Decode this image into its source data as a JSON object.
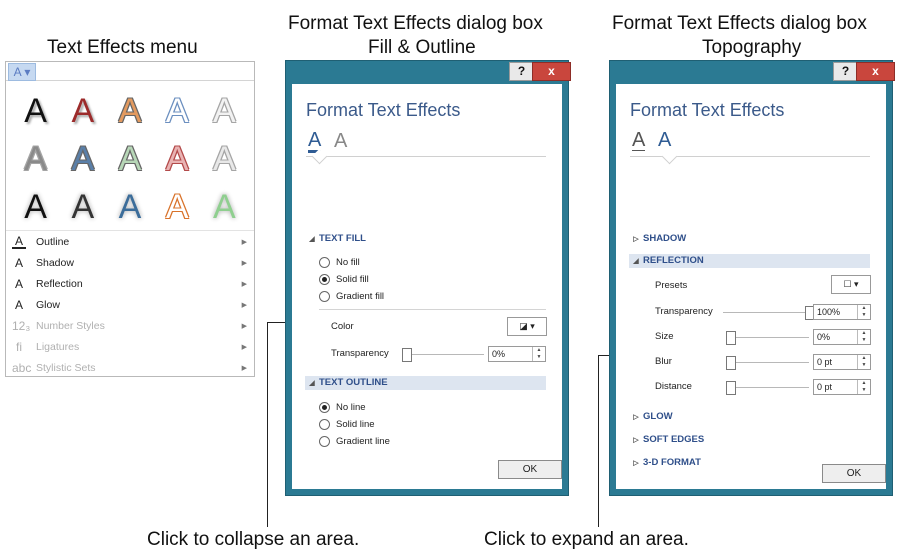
{
  "captions": {
    "menu": "Text Effects menu",
    "dialog1_line1": "Format Text Effects dialog box",
    "dialog1_line2": "Fill & Outline",
    "dialog2_line1": "Format Text Effects dialog box",
    "dialog2_line2": "Topography",
    "collapse": "Click to collapse an area.",
    "expand": "Click to expand an area."
  },
  "menu": {
    "dropdown_glyph": "A ▾",
    "gallery": [
      {
        "letter": "A",
        "color": "#111111",
        "style": "shadow"
      },
      {
        "letter": "A",
        "color": "#9c2b2b",
        "style": "shadow"
      },
      {
        "letter": "A",
        "color": "#e39a5f",
        "style": "outline"
      },
      {
        "letter": "A",
        "color": "#ffffff",
        "style": "outline-blue"
      },
      {
        "letter": "A",
        "color": "#f2f2f2",
        "style": "outline-gray"
      },
      {
        "letter": "A",
        "color": "#8a8a8a",
        "style": "outline-gray"
      },
      {
        "letter": "A",
        "color": "#5a7fa8",
        "style": "outline"
      },
      {
        "letter": "A",
        "color": "#b7d7b7",
        "style": "outline"
      },
      {
        "letter": "A",
        "color": "#e9b3b3",
        "style": "outline-red"
      },
      {
        "letter": "A",
        "color": "#e8e8e8",
        "style": "outline-gray"
      },
      {
        "letter": "A",
        "color": "#111111",
        "style": "glow"
      },
      {
        "letter": "A",
        "color": "#333333",
        "style": "glow"
      },
      {
        "letter": "A",
        "color": "#3c6d9a",
        "style": "glow"
      },
      {
        "letter": "A",
        "color": "#ffffff",
        "style": "outline-orange"
      },
      {
        "letter": "A",
        "color": "#8fcf8f",
        "style": "glow"
      }
    ],
    "items": [
      {
        "icon": "A",
        "label": "Outline",
        "disabled": false
      },
      {
        "icon": "A",
        "label": "Shadow",
        "disabled": false
      },
      {
        "icon": "A",
        "label": "Reflection",
        "disabled": false
      },
      {
        "icon": "A",
        "label": "Glow",
        "disabled": false
      },
      {
        "icon": "12₃",
        "label": "Number Styles",
        "disabled": true
      },
      {
        "icon": "fi",
        "label": "Ligatures",
        "disabled": true
      },
      {
        "icon": "abc",
        "label": "Stylistic Sets",
        "disabled": true
      }
    ],
    "submenu_arrow": "▶"
  },
  "dialog1": {
    "help": "?",
    "close": "x",
    "title": "Format Text Effects",
    "tab_fill": "A",
    "tab_effects": "A",
    "text_fill": {
      "header": "TEXT FILL",
      "options": [
        "No fill",
        "Solid fill",
        "Gradient fill"
      ],
      "selected": 1,
      "color_label": "Color",
      "color_button": "▾",
      "transparency_label": "Transparency",
      "transparency_value": "0%",
      "transparency_level": 0
    },
    "text_outline": {
      "header": "TEXT OUTLINE",
      "options": [
        "No line",
        "Solid line",
        "Gradient line"
      ],
      "selected": 0
    },
    "ok": "OK"
  },
  "dialog2": {
    "help": "?",
    "close": "x",
    "title": "Format Text Effects",
    "tab_fill": "A",
    "tab_effects": "A",
    "shadow_header": "SHADOW",
    "reflection": {
      "header": "REFLECTION",
      "presets_label": "Presets",
      "transparency_label": "Transparency",
      "transparency_value": "100%",
      "transparency_level": 1.0,
      "size_label": "Size",
      "size_value": "0%",
      "blur_label": "Blur",
      "blur_value": "0 pt",
      "distance_label": "Distance",
      "distance_value": "0 pt"
    },
    "glow_header": "GLOW",
    "soft_edges_header": "SOFT EDGES",
    "format_3d_header": "3-D FORMAT",
    "ok": "OK"
  },
  "glyphs": {
    "expanded": "◢",
    "collapsed": "▷",
    "spin": "▲▼"
  }
}
